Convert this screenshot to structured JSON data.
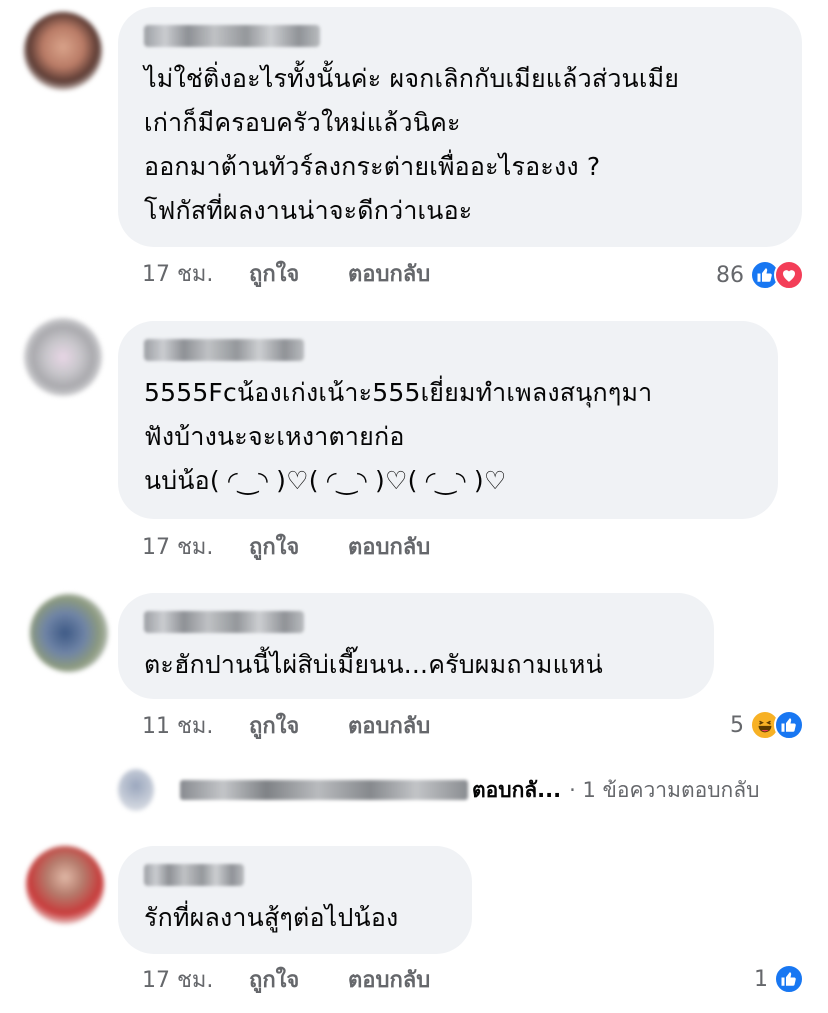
{
  "comments": [
    {
      "lines": [
        "ไม่ใช่ติ่งอะไรทั้งนั้นค่ะ ผจกเลิกกับเมียแล้วส่วนเมีย",
        "เก่าก็มีครอบครัวใหม่แล้วนิคะ",
        "ออกมาต้านทัวร์ลงกระต่ายเพื่ออะไรอะงง ?",
        "โฟกัสที่ผลงานน่าจะดีกว่าเนอะ"
      ],
      "time": "17 ชม.",
      "like_label": "ถูกใจ",
      "reply_label": "ตอบกลับ",
      "reaction_count": "86",
      "reactions": [
        "like-icon",
        "love-icon"
      ]
    },
    {
      "lines": [
        "5555Fcน้องเก่งเน้าะ555เยี่ยมทำเพลงสนุกๆมา",
        "ฟังบ้างนะจะเหงาตายก่อ",
        "นบ่น้อ( ◜‿◝ )♡( ◜‿◝ )♡( ◜‿◝ )♡"
      ],
      "time": "17 ชม.",
      "like_label": "ถูกใจ",
      "reply_label": "ตอบกลับ"
    },
    {
      "lines": [
        "ตะฮักปานนี้ไผ่สิบ่เมี๊ยนน...ครับผมถามแหน่"
      ],
      "time": "11 ชม.",
      "like_label": "ถูกใจ",
      "reply_label": "ตอบกลับ",
      "reaction_count": "5",
      "reactions": [
        "haha-icon",
        "like-icon"
      ]
    },
    {
      "lines": [
        "รักที่ผลงานสู้ๆต่อไปน้อง"
      ],
      "time": "17 ชม.",
      "like_label": "ถูกใจ",
      "reply_label": "ตอบกลับ",
      "reaction_count": "1",
      "reactions": [
        "like-icon"
      ]
    }
  ],
  "reply_thread": {
    "label": "ตอบกลั...",
    "summary": "· 1 ข้อความตอบกลับ"
  },
  "colors": {
    "bubble": "#f0f2f5",
    "meta_text": "#65676b",
    "like": "#1877f2",
    "love": "#f33e58",
    "haha": "#f7b125"
  }
}
